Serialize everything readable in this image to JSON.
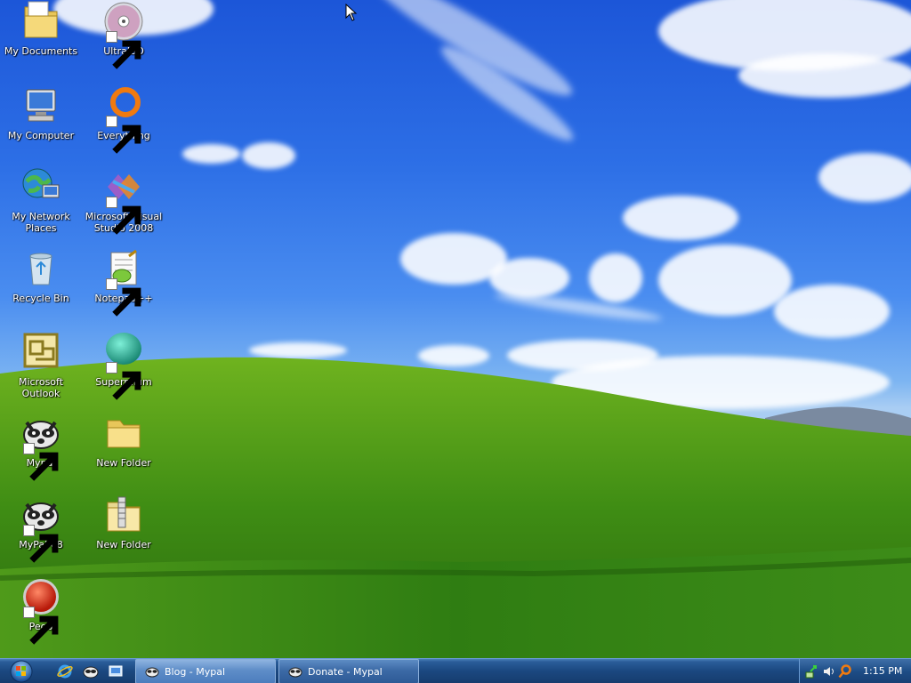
{
  "desktop": {
    "icons_left": [
      {
        "label": "My Documents",
        "icon": "my-documents-folder-icon"
      },
      {
        "label": "My Computer",
        "icon": "my-computer-icon"
      },
      {
        "label": "My Network Places",
        "icon": "network-places-icon"
      },
      {
        "label": "Recycle Bin",
        "icon": "recycle-bin-icon"
      },
      {
        "label": "Microsoft Outlook",
        "icon": "outlook-icon"
      },
      {
        "label": "Mypal",
        "icon": "mypal-raccoon-icon"
      },
      {
        "label": "MyPal 68",
        "icon": "mypal-raccoon-icon"
      },
      {
        "label": "Pego",
        "icon": "pego-red-orb-icon"
      }
    ],
    "icons_right": [
      {
        "label": "UltraISO",
        "icon": "cd-disc-icon"
      },
      {
        "label": "Everything",
        "icon": "everything-search-icon"
      },
      {
        "label": "Microsoft Visual Studio 2008",
        "icon": "visual-studio-icon"
      },
      {
        "label": "Notepad++",
        "icon": "notepadpp-icon"
      },
      {
        "label": "Supermium",
        "icon": "supermium-icon"
      },
      {
        "label": "New Folder",
        "icon": "folder-icon"
      },
      {
        "label": "New Folder",
        "icon": "zip-folder-icon"
      }
    ]
  },
  "taskbar": {
    "start": "start-orb-icon",
    "quick_launch": [
      "internet-explorer-icon",
      "mypal-icon",
      "show-desktop-icon"
    ],
    "tasks": [
      {
        "label": "Blog - Mypal",
        "state": "active"
      },
      {
        "label": "Donate - Mypal",
        "state": "inactive"
      }
    ],
    "tray_icons": [
      "network-icon",
      "volume-icon",
      "search-tray-icon"
    ],
    "clock": "1:15 PM"
  }
}
